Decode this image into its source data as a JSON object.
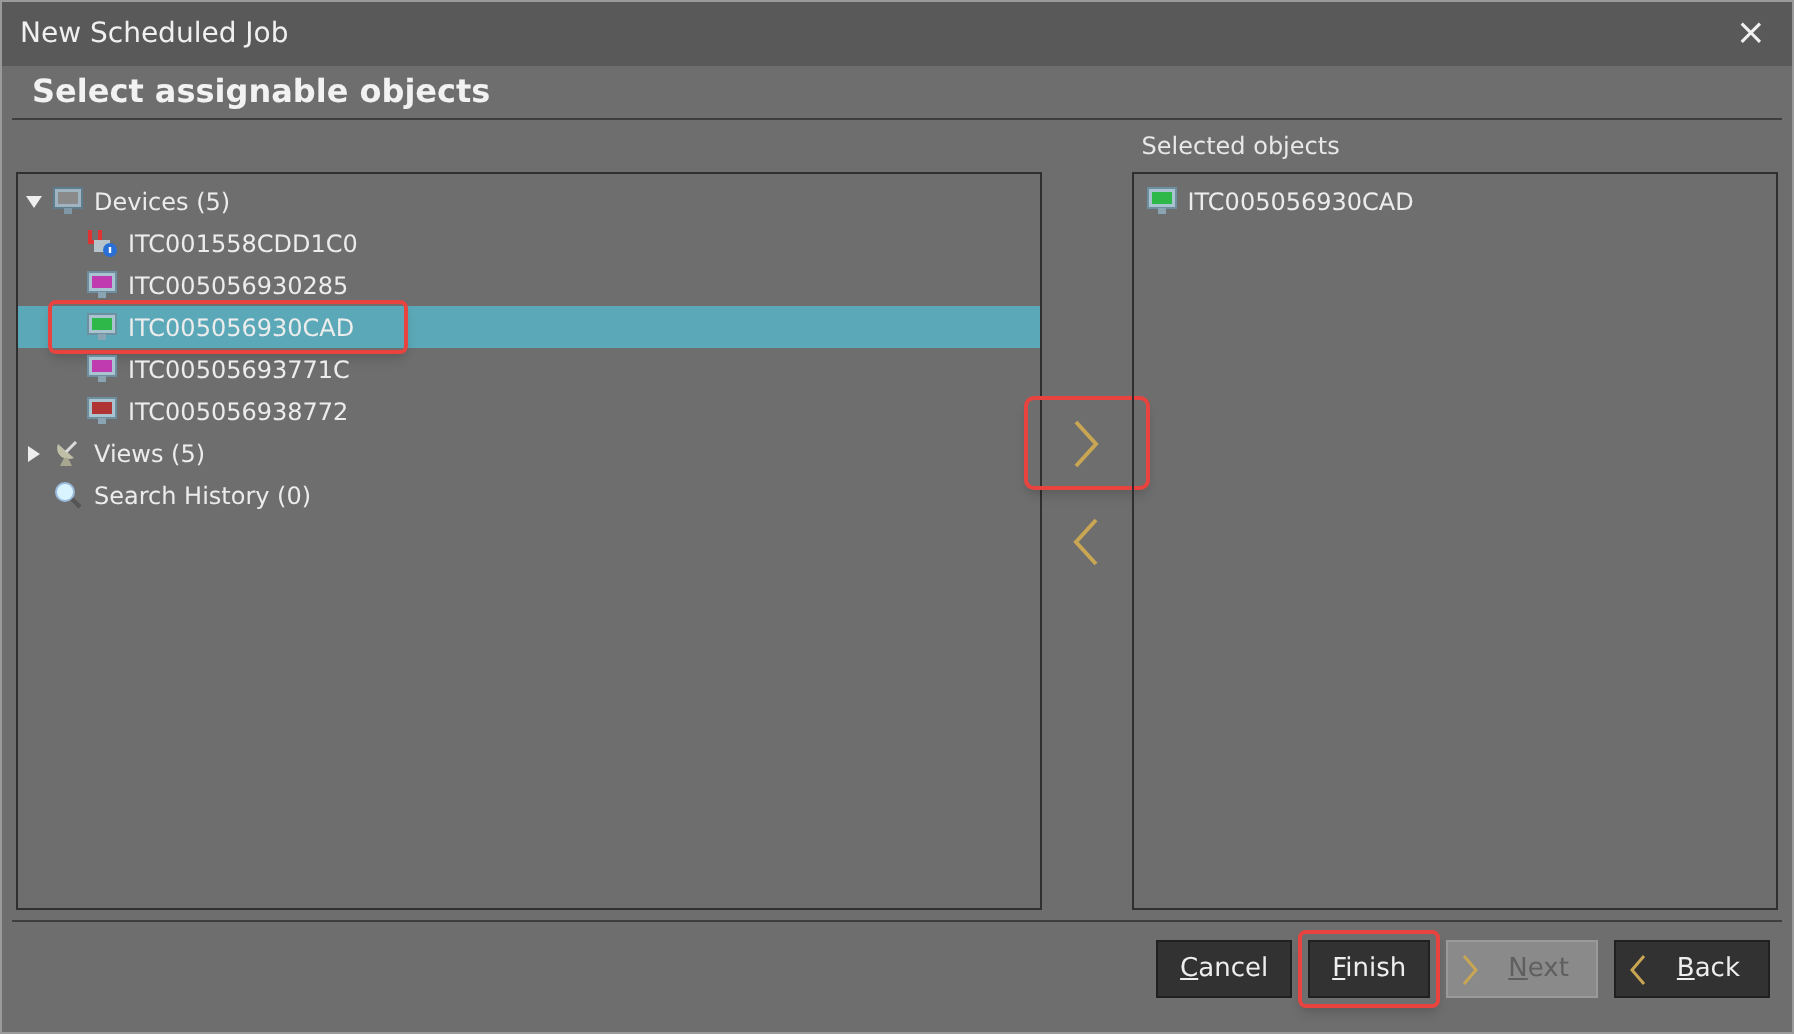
{
  "window": {
    "title": "New Scheduled Job",
    "close": "×"
  },
  "heading": "Select assignable objects",
  "tree": [
    {
      "label": "Devices (5)",
      "kind": "devices",
      "expanded": true,
      "selected": false,
      "children": [
        {
          "label": "ITC001558CDD1C0",
          "kind": "device-alert",
          "selected": false,
          "highlighted": false
        },
        {
          "label": "ITC005056930285",
          "kind": "monitor",
          "color": "#c03ab0",
          "selected": false,
          "highlighted": false
        },
        {
          "label": "ITC005056930CAD",
          "kind": "monitor",
          "color": "#2fb84a",
          "selected": true,
          "highlighted": true
        },
        {
          "label": "ITC00505693771C",
          "kind": "monitor",
          "color": "#c03ab0",
          "selected": false,
          "highlighted": false
        },
        {
          "label": "ITC005056938772",
          "kind": "monitor",
          "color": "#b03434",
          "selected": false,
          "highlighted": false
        }
      ]
    },
    {
      "label": "Views (5)",
      "kind": "views",
      "expanded": false,
      "selected": false
    },
    {
      "label": "Search History (0)",
      "kind": "search",
      "selected": false
    }
  ],
  "selected_label": "Selected objects",
  "selected_items": [
    {
      "label": "ITC005056930CAD",
      "kind": "monitor",
      "color": "#2fb84a"
    }
  ],
  "move_buttons": [
    {
      "kind": "add",
      "highlighted": true
    },
    {
      "kind": "remove",
      "highlighted": false
    }
  ],
  "buttons": [
    {
      "label": "Cancel",
      "mnemonic_underlined": true,
      "kind": "plain",
      "disabled": false,
      "highlighted": false
    },
    {
      "label": "Finish",
      "mnemonic_underlined": true,
      "kind": "plain",
      "disabled": false,
      "highlighted": true
    },
    {
      "label": "Next",
      "mnemonic_underlined": true,
      "kind": "next",
      "disabled": true,
      "highlighted": false
    },
    {
      "label": "Back",
      "mnemonic_underlined": true,
      "kind": "back",
      "disabled": false,
      "highlighted": false
    }
  ]
}
